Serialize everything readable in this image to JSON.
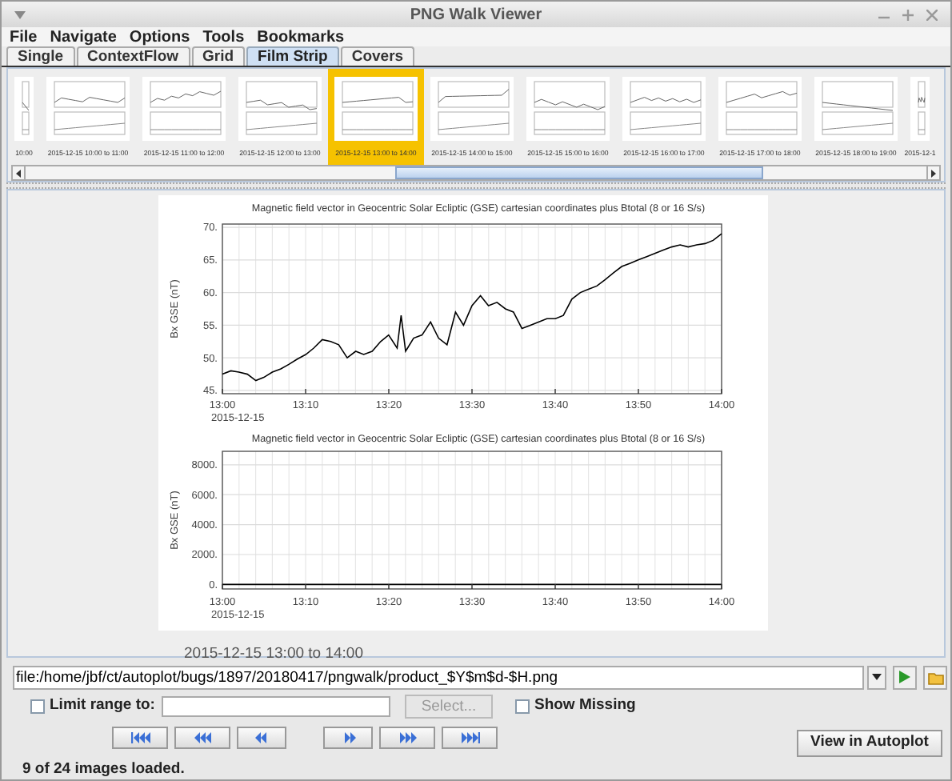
{
  "window": {
    "title": "PNG Walk Viewer"
  },
  "menu": [
    "File",
    "Navigate",
    "Options",
    "Tools",
    "Bookmarks"
  ],
  "tabs": [
    {
      "label": "Single",
      "selected": false
    },
    {
      "label": "ContextFlow",
      "selected": false
    },
    {
      "label": "Grid",
      "selected": false
    },
    {
      "label": "Film Strip",
      "selected": true
    },
    {
      "label": "Covers",
      "selected": false
    }
  ],
  "film_strip": [
    {
      "label": "10:00",
      "selected": false,
      "kind": "partial"
    },
    {
      "label": "2015-12-15 10:00 to 11:00",
      "selected": false,
      "kind": "full"
    },
    {
      "label": "2015-12-15 11:00 to 12:00",
      "selected": false,
      "kind": "full"
    },
    {
      "label": "2015-12-15 12:00 to 13:00",
      "selected": false,
      "kind": "full"
    },
    {
      "label": "2015-12-15 13:00 to 14:00",
      "selected": true,
      "kind": "full"
    },
    {
      "label": "2015-12-15 14:00 to 15:00",
      "selected": false,
      "kind": "full"
    },
    {
      "label": "2015-12-15 15:00 to 16:00",
      "selected": false,
      "kind": "full"
    },
    {
      "label": "2015-12-15 16:00 to 17:00",
      "selected": false,
      "kind": "full"
    },
    {
      "label": "2015-12-15 17:00 to 18:00",
      "selected": false,
      "kind": "full"
    },
    {
      "label": "2015-12-15 18:00 to 19:00",
      "selected": false,
      "kind": "full"
    },
    {
      "label": "2015-12-1",
      "selected": false,
      "kind": "partial"
    }
  ],
  "charts": [
    {
      "date_label": "2015-12-15",
      "chart_data": {
        "type": "line",
        "title": "Magnetic field vector in Geocentric Solar Ecliptic (GSE) cartesian coordinates plus Btotal (8 or 16 S/s)",
        "ylabel": "Bx GSE (nT)",
        "grid": true,
        "xlim": [
          13,
          14
        ],
        "ylim": [
          44.5,
          70.5
        ],
        "x": [
          13,
          13.017,
          13.033,
          13.05,
          13.067,
          13.083,
          13.1,
          13.117,
          13.133,
          13.15,
          13.167,
          13.183,
          13.2,
          13.217,
          13.233,
          13.25,
          13.267,
          13.283,
          13.3,
          13.317,
          13.333,
          13.35,
          13.358,
          13.367,
          13.383,
          13.4,
          13.417,
          13.433,
          13.45,
          13.467,
          13.483,
          13.5,
          13.517,
          13.533,
          13.55,
          13.567,
          13.583,
          13.6,
          13.617,
          13.633,
          13.65,
          13.667,
          13.683,
          13.7,
          13.717,
          13.733,
          13.75,
          13.767,
          13.783,
          13.8,
          13.817,
          13.833,
          13.85,
          13.867,
          13.883,
          13.9,
          13.917,
          13.933,
          13.95,
          13.967,
          13.983,
          14
        ],
        "series": [
          {
            "color": "#000000",
            "values": [
              47.5,
              48,
              47.8,
              47.5,
              46.5,
              47,
              47.8,
              48.3,
              49,
              49.8,
              50.5,
              51.5,
              52.8,
              52.5,
              52,
              50,
              51,
              50.5,
              51,
              52.5,
              53.5,
              51.5,
              56.5,
              51,
              53,
              53.5,
              55.5,
              53,
              52,
              57,
              55,
              58,
              59.5,
              58,
              58.5,
              57.5,
              57,
              54.5,
              55,
              55.5,
              56,
              56,
              56.5,
              59,
              60,
              60.5,
              61,
              62,
              63,
              64,
              64.5,
              65,
              65.5,
              66,
              66.5,
              67,
              67.3,
              67,
              67.3,
              67.5,
              68,
              69
            ]
          }
        ],
        "xticks": [
          {
            "value": 13,
            "label": "13:00"
          },
          {
            "value": 13.1667,
            "label": "13:10"
          },
          {
            "value": 13.3333,
            "label": "13:20"
          },
          {
            "value": 13.5,
            "label": "13:30"
          },
          {
            "value": 13.6667,
            "label": "13:40"
          },
          {
            "value": 13.8333,
            "label": "13:50"
          },
          {
            "value": 14,
            "label": "14:00"
          }
        ],
        "yticks": [
          {
            "value": 45,
            "label": "45."
          },
          {
            "value": 50,
            "label": "50."
          },
          {
            "value": 55,
            "label": "55."
          },
          {
            "value": 60,
            "label": "60."
          },
          {
            "value": 65,
            "label": "65."
          },
          {
            "value": 70,
            "label": "70."
          }
        ]
      }
    },
    {
      "date_label": "2015-12-15",
      "chart_data": {
        "type": "line",
        "title": "Magnetic field vector in Geocentric Solar Ecliptic (GSE) cartesian coordinates plus Btotal (8 or 16 S/s)",
        "ylabel": "Bx GSE (nT)",
        "grid": true,
        "xlim": [
          13,
          14
        ],
        "ylim": [
          -300,
          8900
        ],
        "x": [
          13,
          14
        ],
        "series": [
          {
            "color": "#000000",
            "values": [
              0,
              0
            ]
          }
        ],
        "xticks": [
          {
            "value": 13,
            "label": "13:00"
          },
          {
            "value": 13.1667,
            "label": "13:10"
          },
          {
            "value": 13.3333,
            "label": "13:20"
          },
          {
            "value": 13.5,
            "label": "13:30"
          },
          {
            "value": 13.6667,
            "label": "13:40"
          },
          {
            "value": 13.8333,
            "label": "13:50"
          },
          {
            "value": 14,
            "label": "14:00"
          }
        ],
        "yticks": [
          {
            "value": 0,
            "label": "0."
          },
          {
            "value": 2000,
            "label": "2000."
          },
          {
            "value": 4000,
            "label": "4000."
          },
          {
            "value": 6000,
            "label": "6000."
          },
          {
            "value": 8000,
            "label": "8000."
          }
        ]
      }
    }
  ],
  "caption": "2015-12-15 13:00 to 14:00",
  "template": {
    "value": "file:/home/jbf/ct/autoplot/bugs/1897/20180417/pngwalk/product_$Y$m$d-$H.png"
  },
  "limit_range": {
    "label": "Limit range to:",
    "checked": false
  },
  "select_button": {
    "label": "Select...",
    "disabled": true
  },
  "show_missing": {
    "label": "Show Missing",
    "checked": false
  },
  "nav_buttons": [
    {
      "kind": "first"
    },
    {
      "kind": "prev_page"
    },
    {
      "kind": "prev"
    },
    {
      "kind": "next"
    },
    {
      "kind": "next_page"
    },
    {
      "kind": "last"
    }
  ],
  "view_button": "View in Autoplot",
  "status": "9 of 24 images loaded."
}
